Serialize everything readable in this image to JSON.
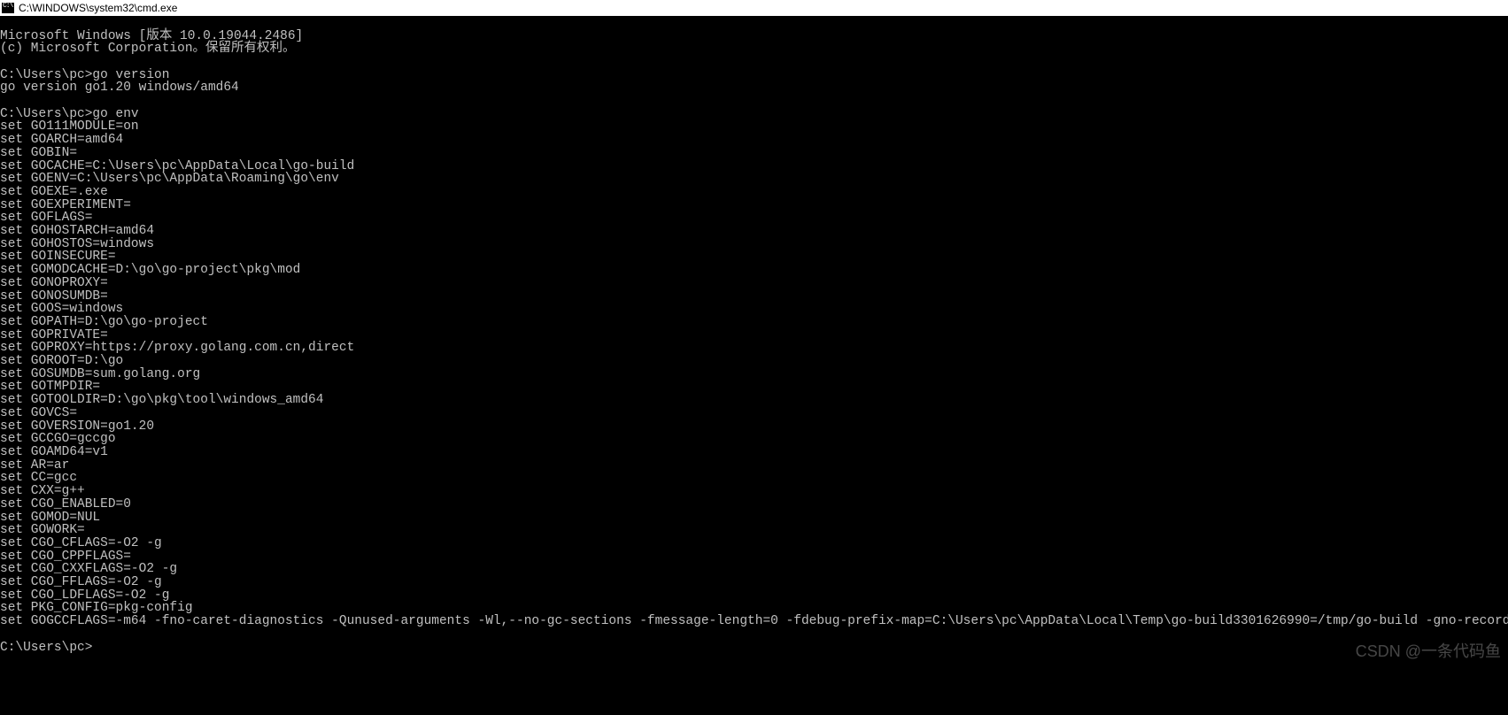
{
  "title": "C:\\WINDOWS\\system32\\cmd.exe",
  "watermark": "CSDN @一条代码鱼",
  "lines": [
    "Microsoft Windows [版本 10.0.19044.2486]",
    "(c) Microsoft Corporation。保留所有权利。",
    "",
    "C:\\Users\\pc>go version",
    "go version go1.20 windows/amd64",
    "",
    "C:\\Users\\pc>go env",
    "set GO111MODULE=on",
    "set GOARCH=amd64",
    "set GOBIN=",
    "set GOCACHE=C:\\Users\\pc\\AppData\\Local\\go-build",
    "set GOENV=C:\\Users\\pc\\AppData\\Roaming\\go\\env",
    "set GOEXE=.exe",
    "set GOEXPERIMENT=",
    "set GOFLAGS=",
    "set GOHOSTARCH=amd64",
    "set GOHOSTOS=windows",
    "set GOINSECURE=",
    "set GOMODCACHE=D:\\go\\go-project\\pkg\\mod",
    "set GONOPROXY=",
    "set GONOSUMDB=",
    "set GOOS=windows",
    "set GOPATH=D:\\go\\go-project",
    "set GOPRIVATE=",
    "set GOPROXY=https://proxy.golang.com.cn,direct",
    "set GOROOT=D:\\go",
    "set GOSUMDB=sum.golang.org",
    "set GOTMPDIR=",
    "set GOTOOLDIR=D:\\go\\pkg\\tool\\windows_amd64",
    "set GOVCS=",
    "set GOVERSION=go1.20",
    "set GCCGO=gccgo",
    "set GOAMD64=v1",
    "set AR=ar",
    "set CC=gcc",
    "set CXX=g++",
    "set CGO_ENABLED=0",
    "set GOMOD=NUL",
    "set GOWORK=",
    "set CGO_CFLAGS=-O2 -g",
    "set CGO_CPPFLAGS=",
    "set CGO_CXXFLAGS=-O2 -g",
    "set CGO_FFLAGS=-O2 -g",
    "set CGO_LDFLAGS=-O2 -g",
    "set PKG_CONFIG=pkg-config",
    "set GOGCCFLAGS=-m64 -fno-caret-diagnostics -Qunused-arguments -Wl,--no-gc-sections -fmessage-length=0 -fdebug-prefix-map=C:\\Users\\pc\\AppData\\Local\\Temp\\go-build3301626990=/tmp/go-build -gno-record-gcc-switches",
    "",
    "C:\\Users\\pc>"
  ]
}
